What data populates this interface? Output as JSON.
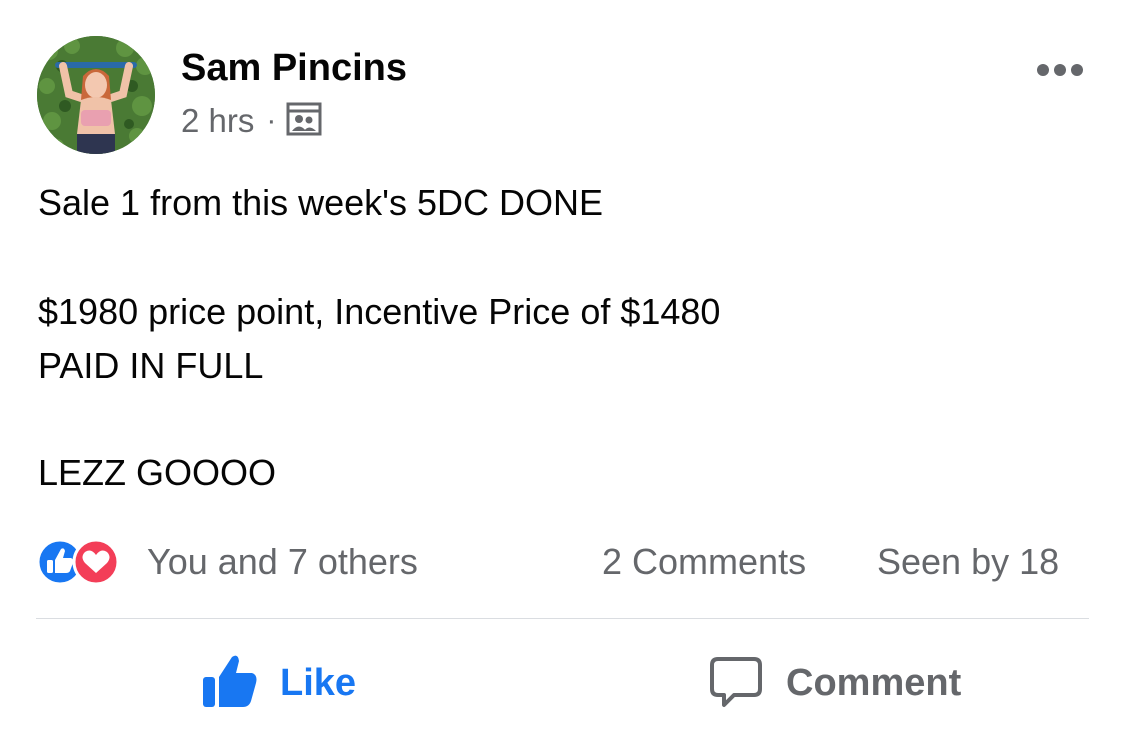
{
  "post": {
    "author": "Sam Pincins",
    "time": "2 hrs",
    "separator": "·",
    "audience_icon": "group-audience-icon",
    "text_lines": [
      "Sale 1 from this week's 5DC DONE",
      "$1980 price point, Incentive Price of $1480",
      "PAID IN FULL",
      "LEZZ GOOOO"
    ]
  },
  "engagement": {
    "reactions_text": "You and 7 others",
    "reaction_icons": [
      "like-reaction-icon",
      "love-reaction-icon"
    ],
    "comments": "2 Comments",
    "seen_by": "Seen by 18"
  },
  "actions": {
    "like_label": "Like",
    "comment_label": "Comment"
  },
  "colors": {
    "brand_blue": "#1877f2",
    "love_red": "#f33e58",
    "secondary_text": "#65676b"
  }
}
